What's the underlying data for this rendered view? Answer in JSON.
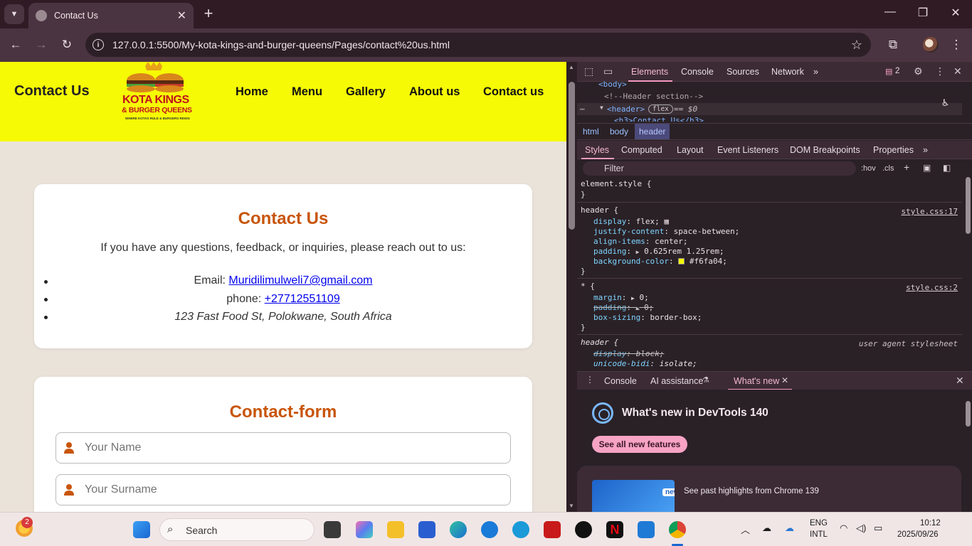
{
  "browser": {
    "tab_title": "Contact Us",
    "url": "127.0.0.1:5500/My-kota-kings-and-burger-queens/Pages/contact%20us.html"
  },
  "site": {
    "header_title": "Contact Us",
    "logo": {
      "line1": "KOTA KINGS",
      "line2": "& BURGER QUEENS",
      "tagline": "WHERE KOTAS RULE & BURGERS REIGN"
    },
    "nav": [
      "Home",
      "Menu",
      "Gallery",
      "About us",
      "Contact us"
    ],
    "contact_card": {
      "heading": "Contact Us",
      "intro": "If you have any questions, feedback, or inquiries, please reach out to us:",
      "email_label": "Email: ",
      "email": "Muridilimulweli7@gmail.com",
      "phone_label": "phone: ",
      "phone": "+27712551109",
      "address": "123 Fast Food St, Polokwane, South Africa"
    },
    "form_card": {
      "heading": "Contact-form",
      "name_placeholder": "Your Name",
      "surname_placeholder": "Your Surname"
    },
    "colors": {
      "header_bg": "#f6fa04",
      "accent": "#c8550a",
      "page_bg": "#eae3da"
    }
  },
  "devtools": {
    "tabs": [
      "Elements",
      "Console",
      "Sources",
      "Network"
    ],
    "issues_count": "2",
    "dom": {
      "body": "<body>",
      "comment": "<!--Header section-->",
      "header_tag": "<header>",
      "flex_badge": "flex",
      "eq": "== $0",
      "h3_partial": "<h3>Contact Us</h3>"
    },
    "breadcrumbs": [
      "html",
      "body",
      "header"
    ],
    "subtabs": [
      "Styles",
      "Computed",
      "Layout",
      "Event Listeners",
      "DOM Breakpoints",
      "Properties"
    ],
    "filter_placeholder": "Filter",
    "hov": ":hov",
    "cls": ".cls",
    "styles": {
      "element_style": "element.style {",
      "close": "}",
      "header_rule": {
        "selector": "header {",
        "source": "style.css:17",
        "props": [
          {
            "name": "display",
            "value": "flex;"
          },
          {
            "name": "justify-content",
            "value": "space-between;"
          },
          {
            "name": "align-items",
            "value": "center;"
          },
          {
            "name": "padding",
            "value": "0.625rem 1.25rem;"
          },
          {
            "name": "background-color",
            "value": "#f6fa04;"
          }
        ]
      },
      "star_rule": {
        "selector": "* {",
        "source": "style.css:2",
        "props": [
          {
            "name": "margin",
            "value": "0;"
          },
          {
            "name": "padding",
            "value": "0;"
          },
          {
            "name": "box-sizing",
            "value": "border-box;"
          }
        ]
      },
      "ua_rule": {
        "selector": "header {",
        "source": "user agent stylesheet",
        "props": [
          {
            "name": "display",
            "value": "block;"
          },
          {
            "name": "unicode-bidi",
            "value": "isolate;"
          }
        ]
      }
    },
    "drawer": {
      "tabs": [
        "Console",
        "AI assistance",
        "What's new"
      ],
      "title": "What's new in DevTools 140",
      "button": "See all new features",
      "card_badge": "new",
      "card_text": "See past highlights from Chrome 139"
    }
  },
  "taskbar": {
    "search": "Search",
    "weather_badge": "2",
    "lang": "ENG",
    "layout": "INTL",
    "time": "10:12",
    "date": "2025/09/26"
  }
}
